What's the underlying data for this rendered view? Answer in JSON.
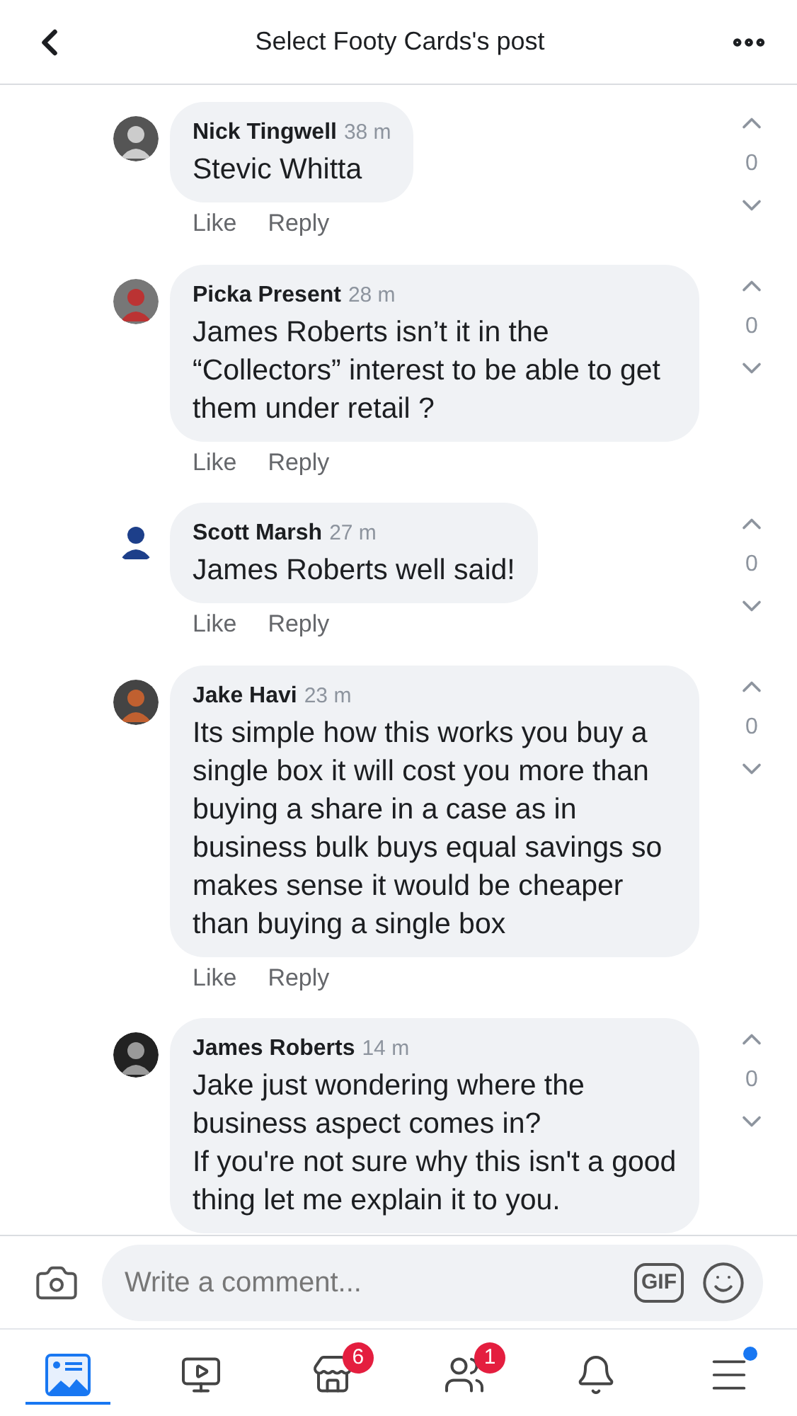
{
  "header": {
    "title": "Select Footy Cards's post"
  },
  "comments": [
    {
      "name": "Nick Tingwell",
      "time": "38 m",
      "text": "Stevic Whitta",
      "actions": [
        "Like",
        "Reply"
      ],
      "score": "0"
    },
    {
      "name": "Picka Present",
      "time": "28 m",
      "text": "James Roberts isn’t it in the “Collectors” interest to be able to get them under retail ?",
      "actions": [
        "Like",
        "Reply"
      ],
      "score": "0"
    },
    {
      "name": "Scott Marsh",
      "time": "27 m",
      "text": "James Roberts well said!",
      "actions": [
        "Like",
        "Reply"
      ],
      "score": "0"
    },
    {
      "name": "Jake Havi",
      "time": "23 m",
      "text": "Its simple how this works you buy a single box it will cost you more than buying a share in a case as in business bulk buys equal savings so makes sense it would be cheaper than buying a single box",
      "actions": [
        "Like",
        "Reply"
      ],
      "score": "0"
    },
    {
      "name": "James Roberts",
      "time": "14 m",
      "text": "Jake just wondering where the business aspect comes in?\nIf you're not sure why this isn't a good thing let me explain it to you.",
      "score": "0"
    }
  ],
  "composer": {
    "placeholder": "Write a comment...",
    "gif": "GIF"
  },
  "tabs": [
    {
      "kind": "news",
      "selected": true
    },
    {
      "kind": "watch",
      "selected": false
    },
    {
      "kind": "market",
      "selected": false,
      "badge": "6"
    },
    {
      "kind": "groups",
      "selected": false,
      "badge": "1"
    },
    {
      "kind": "notifications",
      "selected": false
    },
    {
      "kind": "menu",
      "selected": false,
      "dot": true
    }
  ]
}
